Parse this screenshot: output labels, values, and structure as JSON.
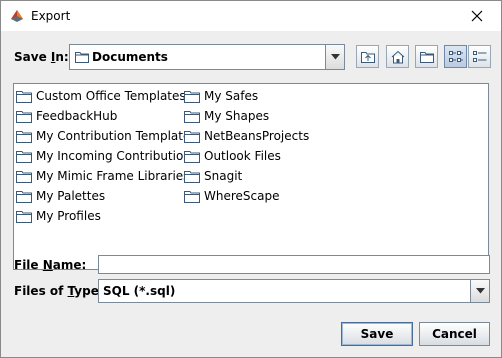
{
  "window": {
    "title": "Export"
  },
  "save_in": {
    "label_pre": "Save ",
    "label_mnemonic": "I",
    "label_post": "n:",
    "value": "Documents"
  },
  "toolbar": {
    "icons": [
      "up-one-level-icon",
      "home-icon",
      "new-folder-icon",
      "list-view-icon",
      "details-view-icon"
    ],
    "active_view": "list"
  },
  "files": {
    "column1": [
      "Custom Office Templates",
      "FeedbackHub",
      "My Contribution Templates",
      "My Incoming Contributions",
      "My Mimic Frame Libraries",
      "My Palettes",
      "My Profiles"
    ],
    "column2": [
      "My Safes",
      "My Shapes",
      "NetBeansProjects",
      "Outlook Files",
      "Snagit",
      "WhereScape"
    ]
  },
  "file_name": {
    "label_pre": "File ",
    "label_mnemonic": "N",
    "label_post": "ame:",
    "value": ""
  },
  "file_type": {
    "label_pre": "Files of ",
    "label_mnemonic": "T",
    "label_post": "ype:",
    "value": "SQL (*.sql)"
  },
  "buttons": {
    "save": "Save",
    "cancel": "Cancel"
  },
  "colors": {
    "folder_fill": "#ffffff",
    "folder_stroke": "#3c5a78",
    "window_bg": "#eeeeee",
    "default_button_border": "#4a6d95"
  }
}
